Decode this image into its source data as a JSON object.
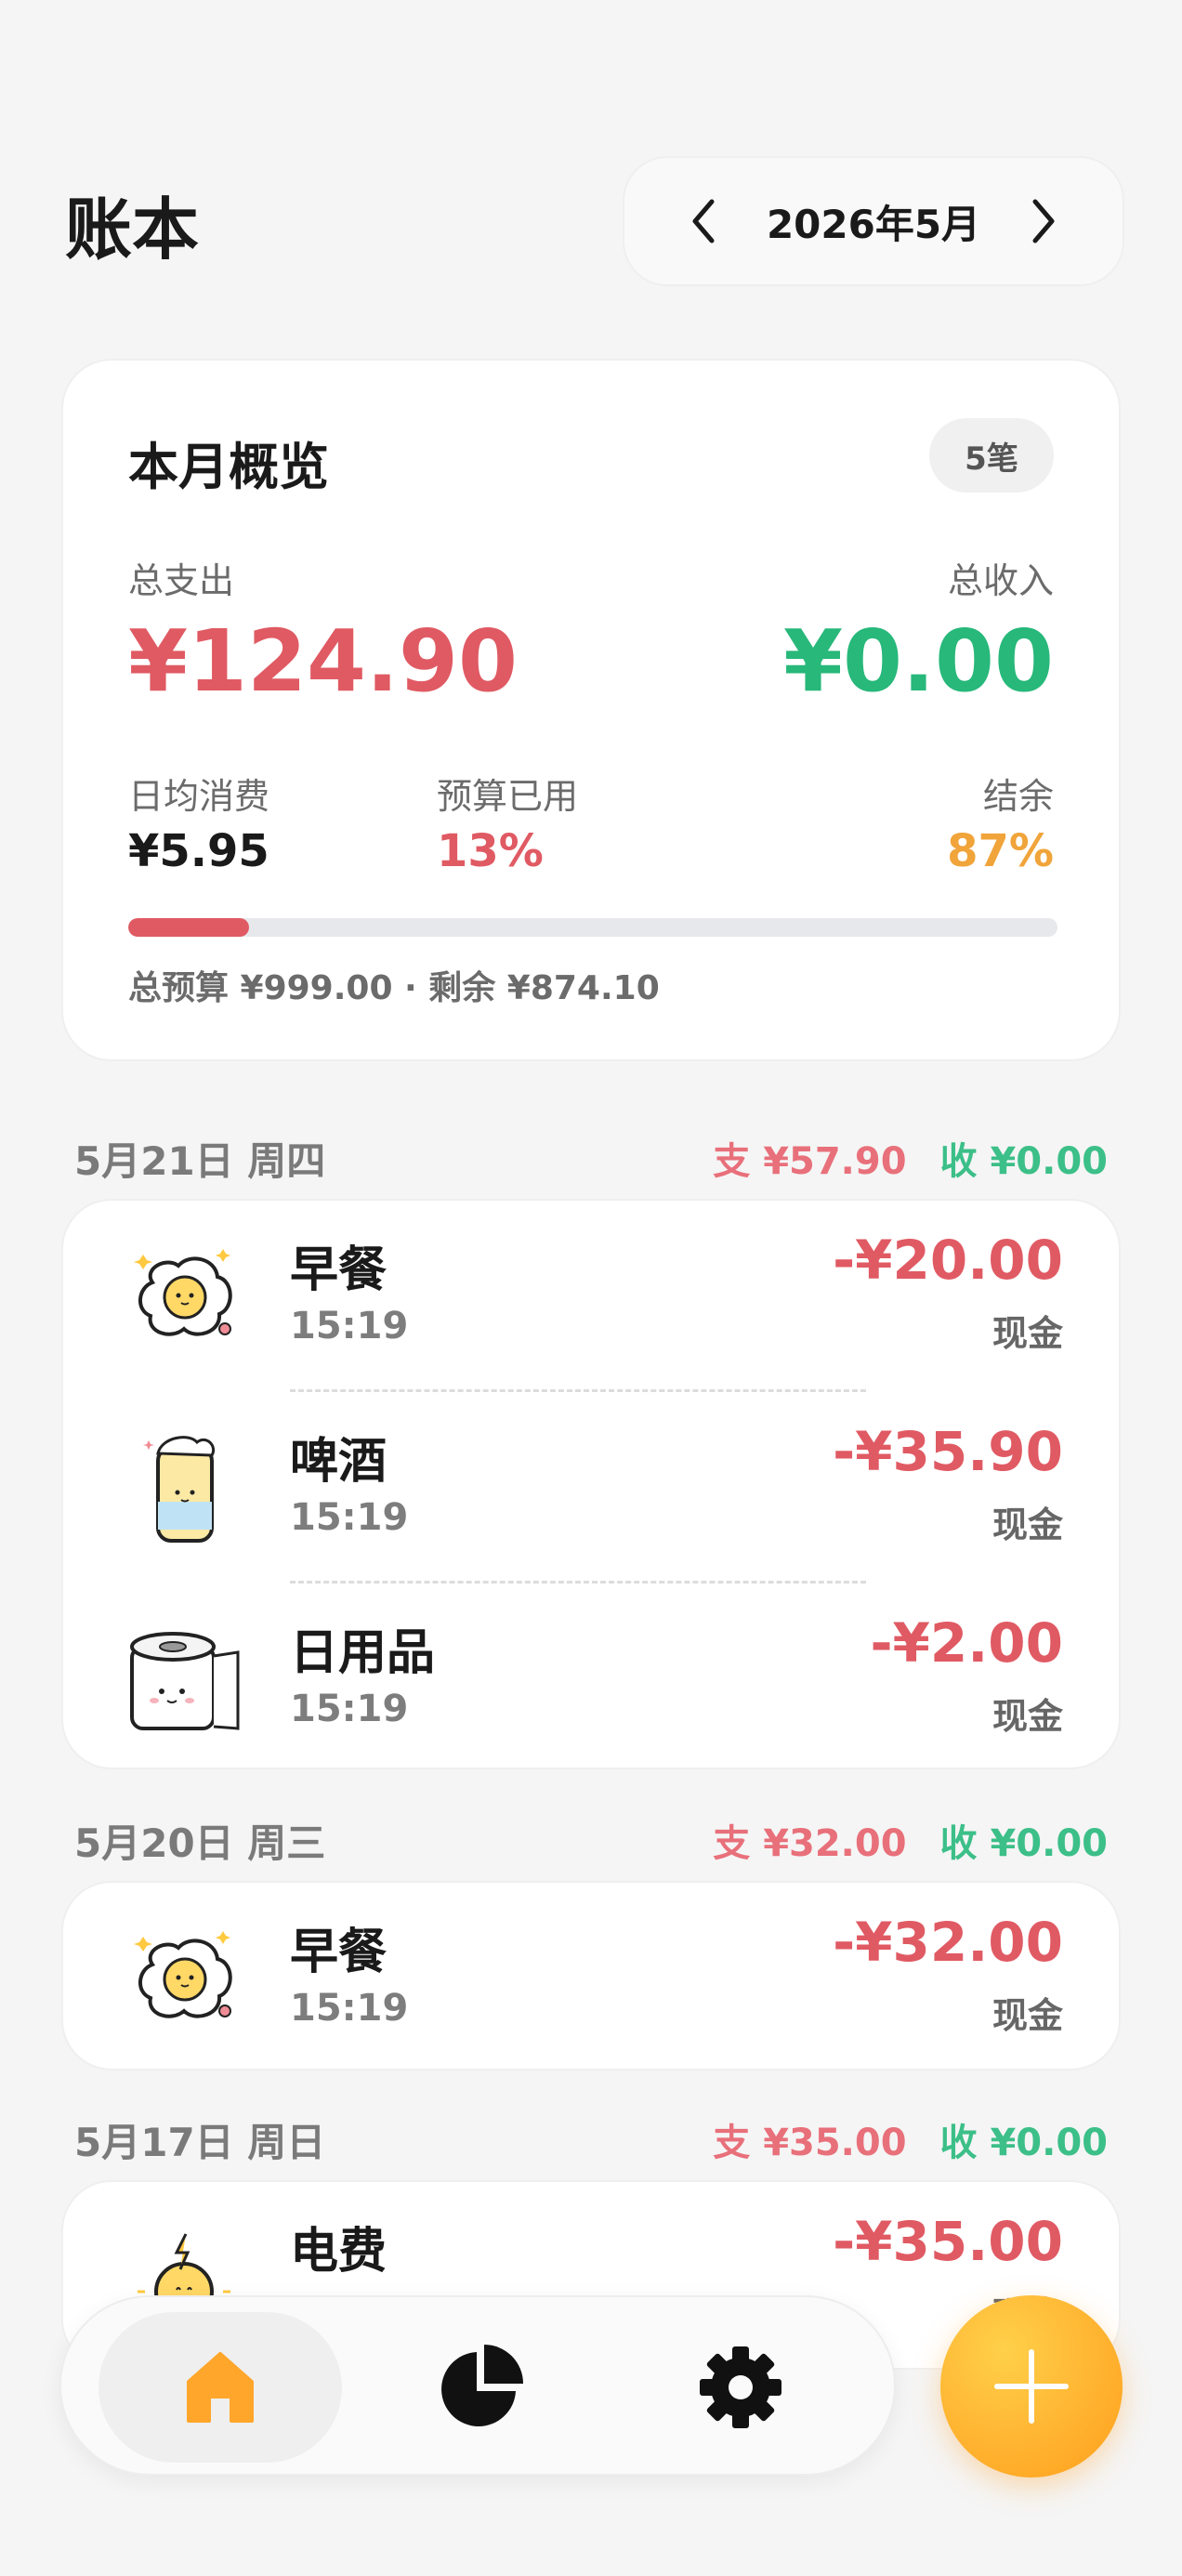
{
  "header": {
    "title": "账本",
    "month": "2026年5月"
  },
  "overview": {
    "title": "本月概览",
    "count_badge": "5笔",
    "total_expense_label": "总支出",
    "total_expense": "¥124.90",
    "total_income_label": "总收入",
    "total_income": "¥0.00",
    "daily_avg_label": "日均消费",
    "daily_avg": "¥5.95",
    "budget_used_label": "预算已用",
    "budget_used": "13%",
    "budget_used_fraction": 0.13,
    "balance_label": "结余",
    "balance": "87%",
    "budget_line": "总预算 ¥999.00 · 剩余 ¥874.10"
  },
  "days": [
    {
      "date": "5月21日 周四",
      "expense": "支 ¥57.90",
      "income": "收 ¥0.00",
      "entries": [
        {
          "name": "早餐",
          "time": "15:19",
          "amount": "-¥20.00",
          "method": "现金",
          "icon": "fried-egg-icon"
        },
        {
          "name": "啤酒",
          "time": "15:19",
          "amount": "-¥35.90",
          "method": "现金",
          "icon": "beer-can-icon"
        },
        {
          "name": "日用品",
          "time": "15:19",
          "amount": "-¥2.00",
          "method": "现金",
          "icon": "toilet-paper-icon"
        }
      ]
    },
    {
      "date": "5月20日 周三",
      "expense": "支 ¥32.00",
      "income": "收 ¥0.00",
      "entries": [
        {
          "name": "早餐",
          "time": "15:19",
          "amount": "-¥32.00",
          "method": "现金",
          "icon": "fried-egg-icon"
        }
      ]
    },
    {
      "date": "5月17日 周日",
      "expense": "支 ¥35.00",
      "income": "收 ¥0.00",
      "entries": [
        {
          "name": "电费",
          "time": "",
          "amount": "-¥35.00",
          "method": "现金",
          "icon": "lightbulb-icon"
        }
      ]
    }
  ],
  "colors": {
    "expense": "#e05a63",
    "income": "#27b87a",
    "warning": "#f0a43a",
    "accent": "#ffb431"
  },
  "nav": {
    "items": [
      "home-icon",
      "pie-chart-icon",
      "gear-icon"
    ],
    "active": "home-icon"
  }
}
